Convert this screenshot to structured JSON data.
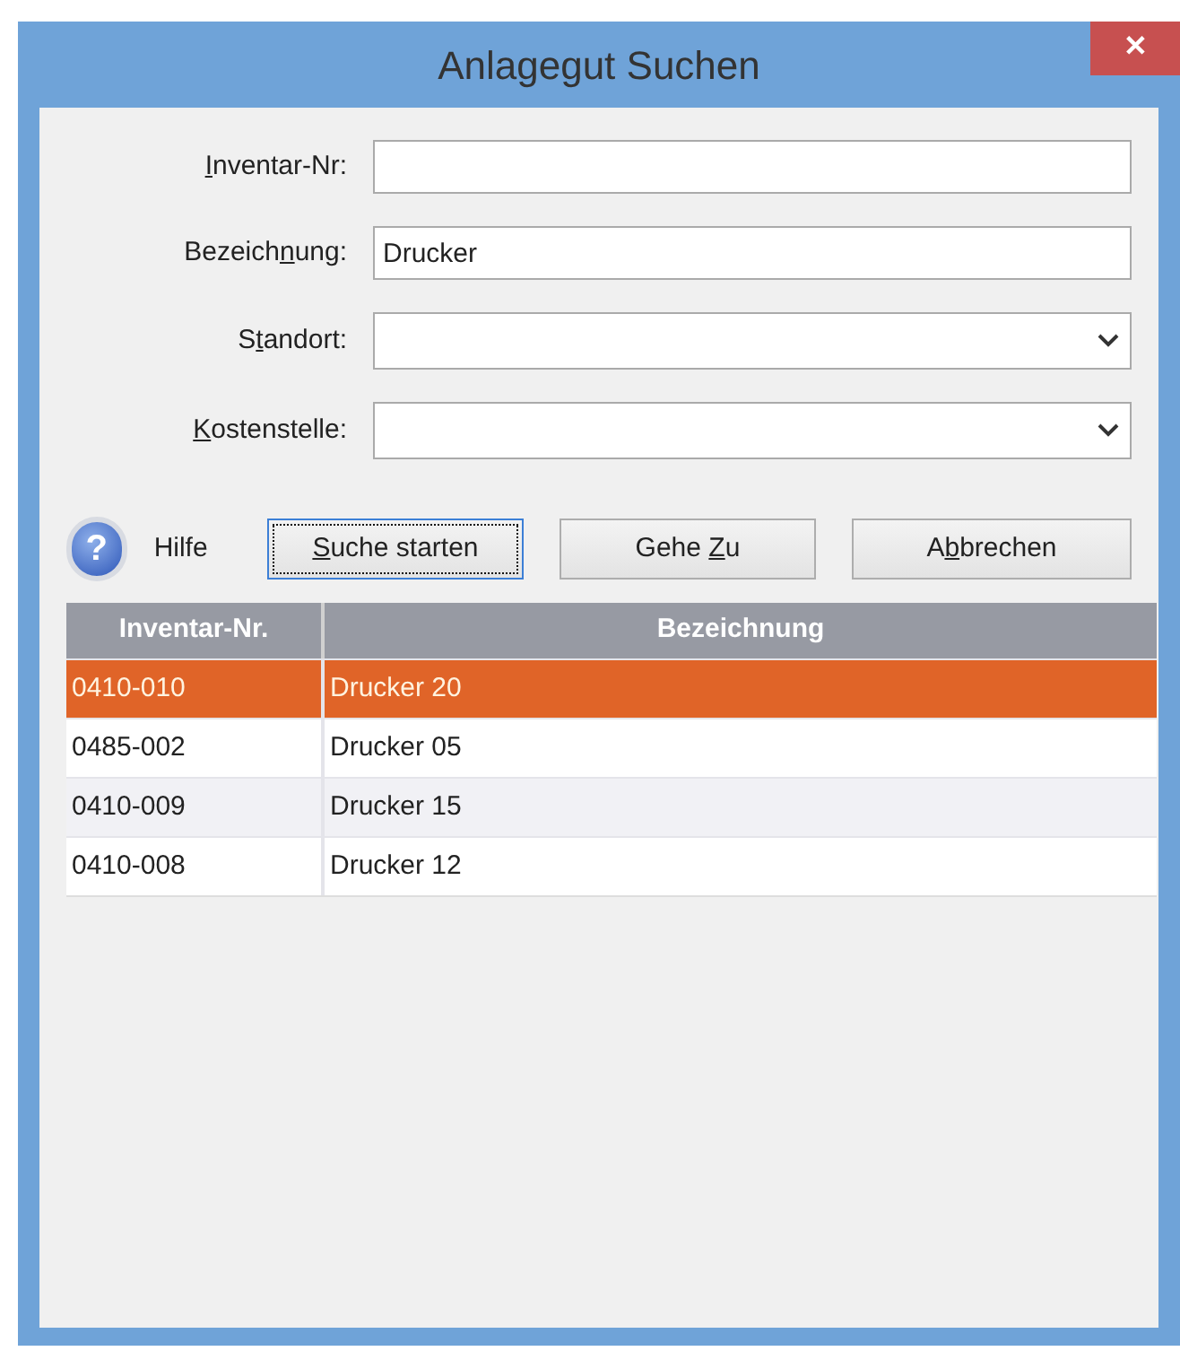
{
  "window": {
    "title": "Anlagegut Suchen",
    "close": "✕"
  },
  "fields": [
    {
      "kind": "text",
      "label": {
        "key": "I",
        "post": "nventar-Nr:"
      }
    },
    {
      "kind": "text",
      "label": {
        "pre": "Bezeich",
        "key": "n",
        "post": "ung:"
      },
      "value": "Drucker"
    },
    {
      "kind": "dropdown",
      "label": {
        "pre": "S",
        "key": "t",
        "post": "andort:"
      }
    },
    {
      "kind": "dropdown",
      "label": {
        "key": "K",
        "post": "ostenstelle:"
      }
    }
  ],
  "help": {
    "icon": "?",
    "label": "Hilfe"
  },
  "buttons": [
    {
      "label": {
        "key": "S",
        "post": "uche starten"
      },
      "focused": true
    },
    {
      "label": {
        "pre": "Gehe ",
        "key": "Z",
        "post": "u"
      },
      "focused": false
    },
    {
      "label": {
        "pre": "A",
        "key": "b",
        "post": "brechen"
      },
      "focused": false
    }
  ],
  "table": {
    "columns": [
      "Inventar-Nr.",
      "Bezeichnung"
    ],
    "rows": [
      {
        "cells": [
          "0410-010",
          "Drucker 20"
        ],
        "selected": true
      },
      {
        "cells": [
          "0485-002",
          "Drucker 05"
        ],
        "selected": false
      },
      {
        "cells": [
          "0410-009",
          "Drucker 15"
        ],
        "selected": false
      },
      {
        "cells": [
          "0410-008",
          "Drucker 12"
        ],
        "selected": false
      }
    ]
  }
}
